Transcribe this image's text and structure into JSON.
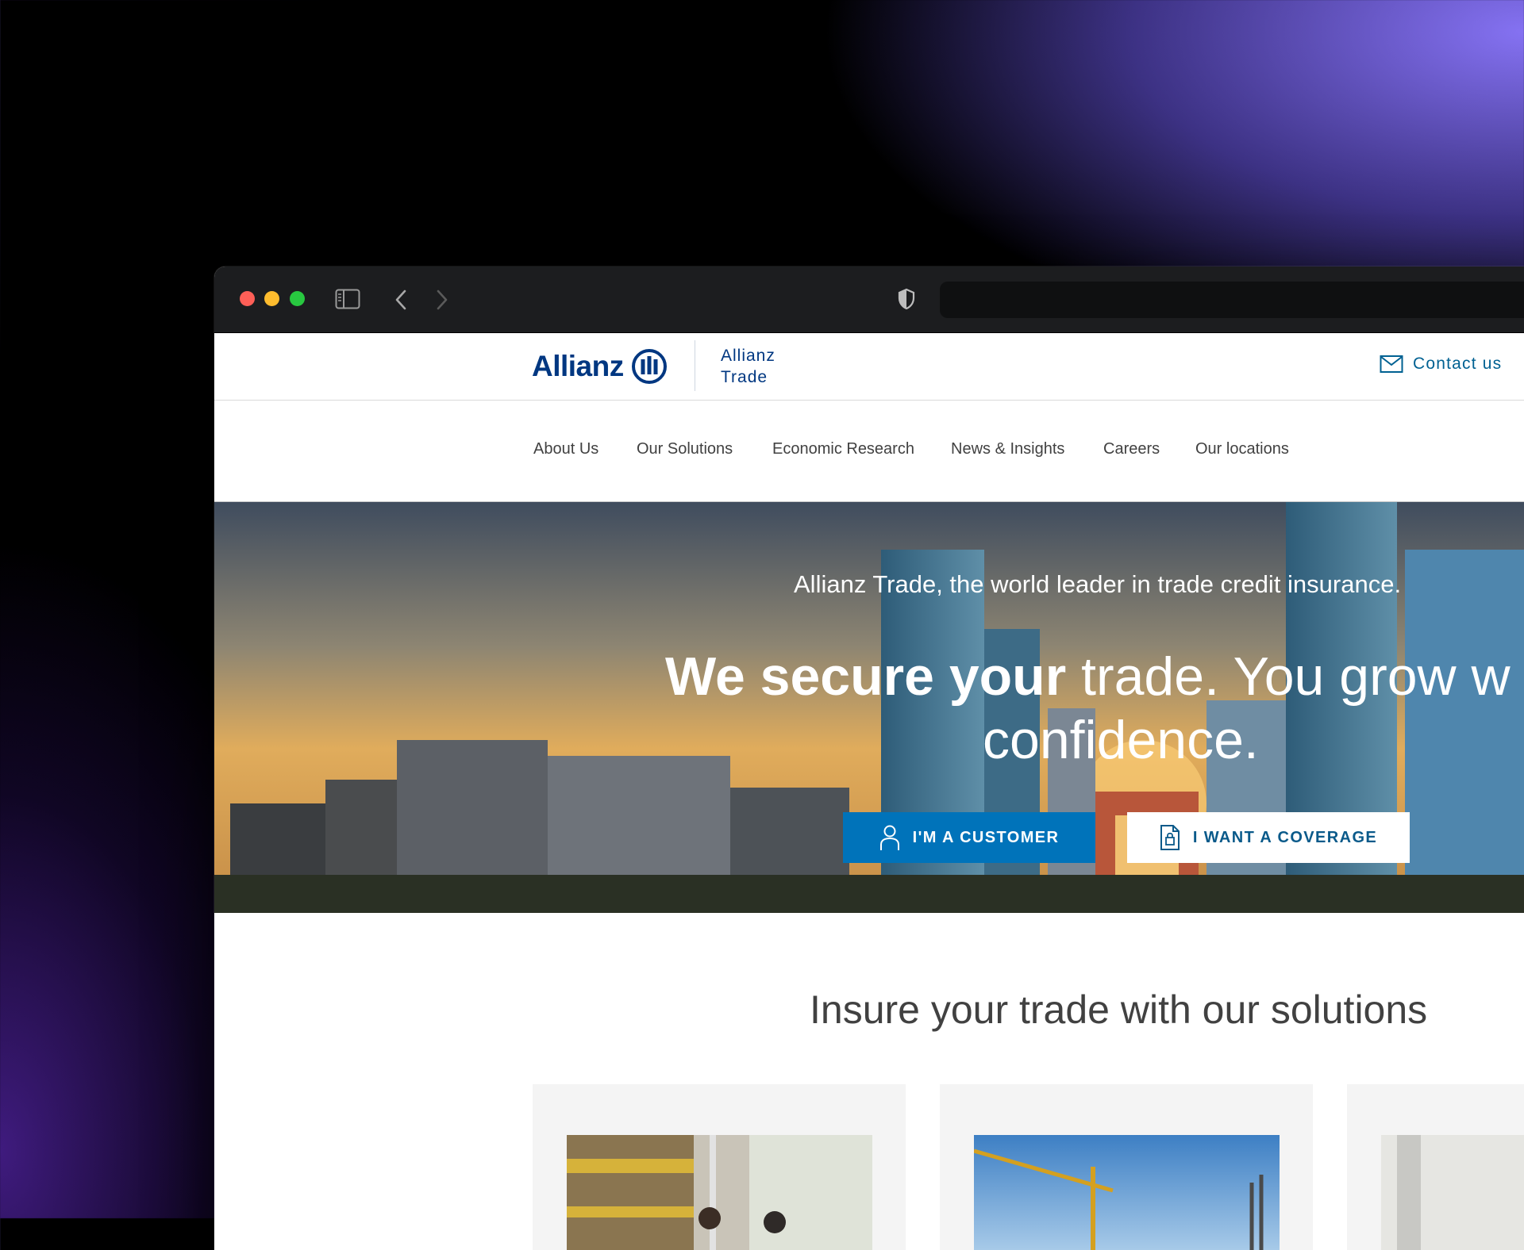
{
  "browser": {
    "sidebar_icon": "sidebar-icon",
    "back_icon": "chevron-left-icon",
    "forward_icon": "chevron-right-icon",
    "privacy_icon": "shield-icon"
  },
  "header": {
    "logo_text": "Allianz",
    "logo_subtitle_line1": "Allianz",
    "logo_subtitle_line2": "Trade",
    "contact_label": "Contact us",
    "contact_icon": "mail-icon"
  },
  "nav": {
    "items": [
      {
        "label": "About Us"
      },
      {
        "label": "Our Solutions"
      },
      {
        "label": "Economic Research"
      },
      {
        "label": "News & Insights"
      },
      {
        "label": "Careers"
      },
      {
        "label": "Our locations"
      }
    ]
  },
  "hero": {
    "subtitle": "Allianz Trade, the world leader in trade credit insurance.",
    "title_bold": "We secure your",
    "title_rest": " trade. You grow w",
    "title_line2": "confidence.",
    "customer_button": "I'M A CUSTOMER",
    "coverage_button": "I WANT A COVERAGE"
  },
  "solutions": {
    "title": "Insure your trade with our solutions"
  },
  "colors": {
    "brand_blue": "#003781",
    "button_blue": "#0073ba",
    "contact_blue": "#006192"
  }
}
